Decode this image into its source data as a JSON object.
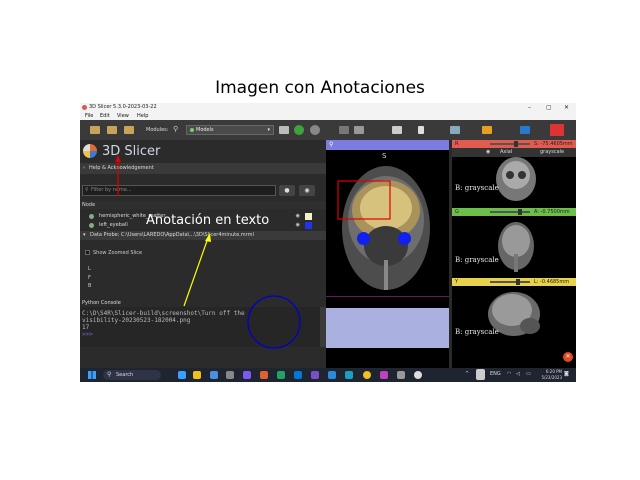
{
  "figure": {
    "title": "Imagen con Anotaciones"
  },
  "window": {
    "title": "3D Slicer 5.3.0-2023-03-22",
    "minimize": "–",
    "maximize": "▢",
    "close": "✕"
  },
  "menu": [
    "File",
    "Edit",
    "View",
    "Help"
  ],
  "toolbar": {
    "modules_label": "Modules:",
    "module_selected": "Models"
  },
  "left": {
    "logo_text": "3D Slicer",
    "help_section": "Help & Acknowledgement",
    "filter_placeholder": "Filter by name...",
    "node_header": "Node",
    "nodes": [
      {
        "name": "hemispheric_white_matter",
        "color": "#f5f0c8"
      },
      {
        "name": "left_eyeball",
        "color": "#2233ee"
      }
    ],
    "probe_label": "Data Probe: C:\\Users\\LAREDO\\AppData\\...\\3D\\Slicer4minute.mrml",
    "show_zoomed": "Show Zoomed Slice",
    "lfb": [
      "L",
      "F",
      "B"
    ],
    "python_label": "Python Console",
    "console_lines": [
      "C:\\D\\S4R\\Slicer-build\\screenshot\\Turn off the",
      "visibility-20230523-182004.png",
      "17"
    ],
    "console_prompt": ">>>"
  },
  "views": {
    "main_letter": "S",
    "red": {
      "letter": "R",
      "value": "S: -75.4605mm",
      "color": "#e25b4e"
    },
    "green": {
      "letter": "G",
      "value": "A: -0.7500mm",
      "color": "#6cc04a"
    },
    "yellow": {
      "letter": "Y",
      "value": "L: -0.4685mm",
      "color": "#e8d24a"
    },
    "orientation": "Axial",
    "volume": "grayscale",
    "slice_label": "B: grayscale"
  },
  "taskbar": {
    "search": "Search",
    "lang": "ENG",
    "time": "6:20 PM",
    "date": "5/23/2023"
  },
  "annotation": {
    "text": "Anotación en texto"
  }
}
